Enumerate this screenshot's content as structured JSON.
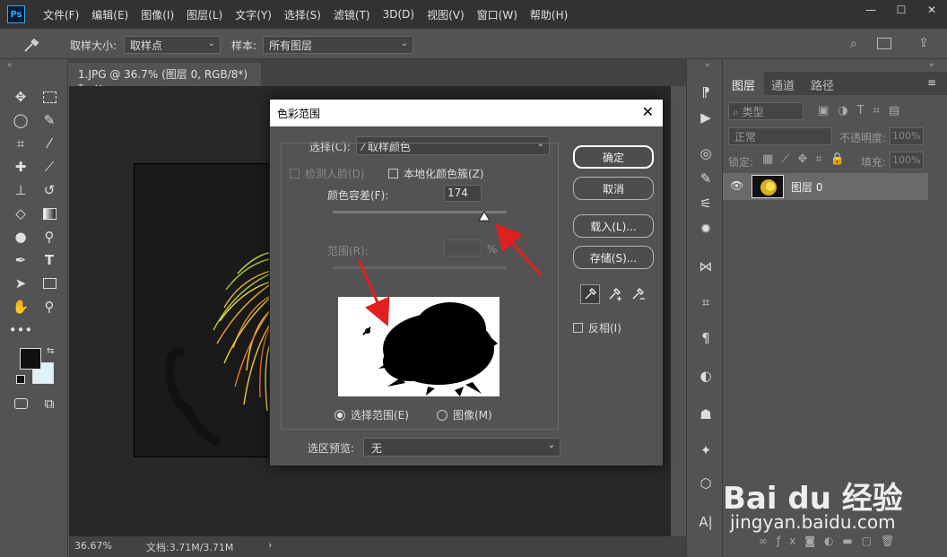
{
  "app": {
    "logo": "Ps"
  },
  "menu": [
    "文件(F)",
    "编辑(E)",
    "图像(I)",
    "图层(L)",
    "文字(Y)",
    "选择(S)",
    "滤镜(T)",
    "3D(D)",
    "视图(V)",
    "窗口(W)",
    "帮助(H)"
  ],
  "window_controls": {
    "minimize": "—",
    "restore": "☐",
    "close": "✕"
  },
  "options_bar": {
    "sample_size_label": "取样大小:",
    "sample_size_value": "取样点",
    "sample_label": "样本:",
    "sample_value": "所有图层"
  },
  "document": {
    "tab_title": "1.JPG @ 36.7% (图层 0, RGB/8*) *",
    "tab_close": "×",
    "zoom": "36.67%",
    "doc_info": "文档:3.71M/3.71M"
  },
  "panel": {
    "tabs": [
      "图层",
      "通道",
      "路径"
    ],
    "filter_label": "类型",
    "blend_mode": "正常",
    "opacity_label": "不透明度:",
    "opacity_value": "100%",
    "lock_label": "锁定:",
    "fill_label": "填充:",
    "fill_value": "100%",
    "layer_name": "图层 0"
  },
  "dialog": {
    "title": "色彩范围",
    "close": "✕",
    "select_label": "选择(C):",
    "select_value": "取样颜色",
    "detect_faces": "检测人脸(D)",
    "localized_clusters": "本地化颜色簇(Z)",
    "fuzziness_label": "颜色容差(F):",
    "fuzziness_value": "174",
    "fuzziness_fraction": 0.87,
    "range_label": "范围(R):",
    "range_unit": "%",
    "radio_selection": "选择范围(E)",
    "radio_image": "图像(M)",
    "preview_label": "选区预览:",
    "preview_value": "无",
    "buttons": {
      "ok": "确定",
      "cancel": "取消",
      "load": "载入(L)...",
      "save": "存储(S)..."
    },
    "invert": "反相(I)"
  },
  "watermark": {
    "brand_cn": "Bai du 经验",
    "url": "jingyan.baidu.com"
  },
  "colors": {
    "arrow": "#e02020",
    "accent": "#31a8ff"
  }
}
